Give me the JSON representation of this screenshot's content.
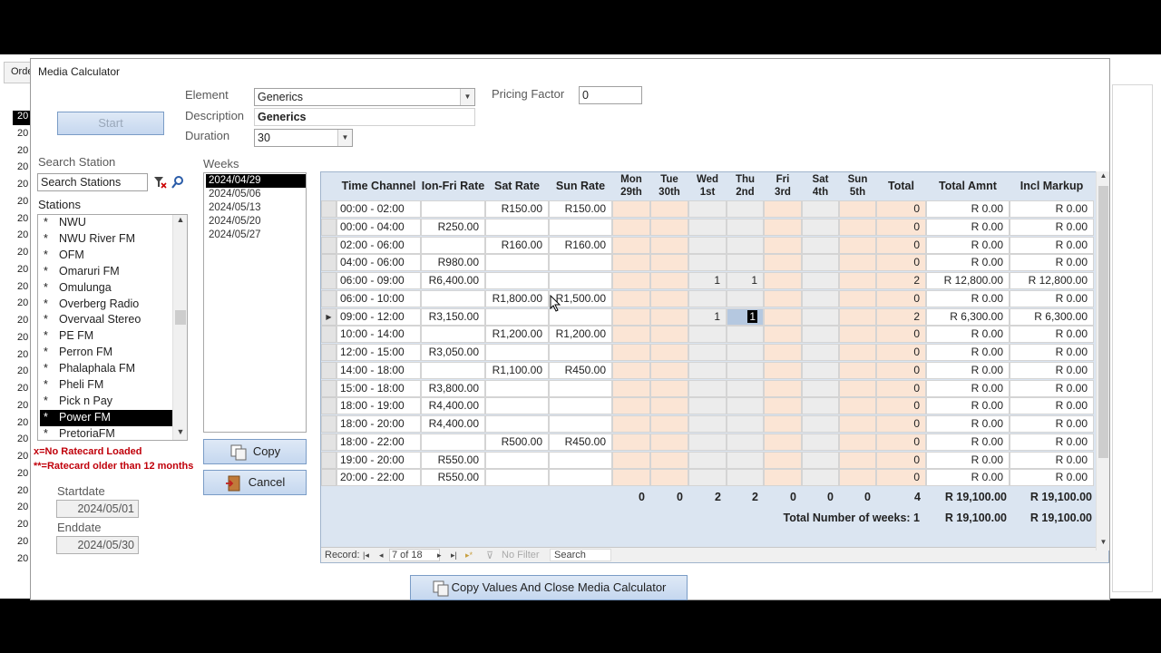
{
  "background_app": {
    "tab_label": "Orde",
    "year_list": [
      "20",
      "20",
      "20",
      "20",
      "20",
      "20",
      "20",
      "20",
      "20",
      "20",
      "20",
      "20",
      "20",
      "20",
      "20",
      "20",
      "20",
      "20",
      "20",
      "20",
      "20",
      "20",
      "20",
      "20",
      "20",
      "20",
      "20"
    ]
  },
  "dialog": {
    "title": "Media Calculator",
    "start_button": "Start",
    "element_label": "Element",
    "element_value": "Generics",
    "description_label": "Description",
    "description_value": "Generics",
    "duration_label": "Duration",
    "duration_value": "30",
    "pricing_factor_label": "Pricing Factor",
    "pricing_factor_value": "0",
    "search_station_label": "Search Station",
    "search_station_value": "Search Stations",
    "stations_label": "Stations",
    "stations": [
      {
        "mark": "*",
        "name": "NWU",
        "selected": false
      },
      {
        "mark": "*",
        "name": "NWU River FM",
        "selected": false
      },
      {
        "mark": "*",
        "name": "OFM",
        "selected": false
      },
      {
        "mark": "*",
        "name": "Omaruri FM",
        "selected": false
      },
      {
        "mark": "*",
        "name": "Omulunga",
        "selected": false
      },
      {
        "mark": "*",
        "name": "Overberg Radio",
        "selected": false
      },
      {
        "mark": "*",
        "name": "Overvaal Stereo",
        "selected": false
      },
      {
        "mark": "*",
        "name": "PE FM",
        "selected": false
      },
      {
        "mark": "*",
        "name": "Perron FM",
        "selected": false
      },
      {
        "mark": "*",
        "name": "Phalaphala FM",
        "selected": false
      },
      {
        "mark": "*",
        "name": "Pheli FM",
        "selected": false
      },
      {
        "mark": "*",
        "name": "Pick n Pay",
        "selected": false
      },
      {
        "mark": "*",
        "name": "Power FM",
        "selected": true
      },
      {
        "mark": "*",
        "name": "PretoriaFM",
        "selected": false
      }
    ],
    "note_no_ratecard": "x=No Ratecard Loaded",
    "note_old_ratecard": "**=Ratecard older than 12 months",
    "startdate_label": "Startdate",
    "startdate_value": "2024/05/01",
    "enddate_label": "Enddate",
    "enddate_value": "2024/05/30",
    "weeks_label": "Weeks",
    "weeks": [
      {
        "label": "2024/04/29",
        "selected": true
      },
      {
        "label": "2024/05/06",
        "selected": false
      },
      {
        "label": "2024/05/13",
        "selected": false
      },
      {
        "label": "2024/05/20",
        "selected": false
      },
      {
        "label": "2024/05/27",
        "selected": false
      }
    ],
    "copy_button": "Copy",
    "cancel_button": "Cancel",
    "copy_close_button": "Copy Values And Close Media Calculator"
  },
  "grid": {
    "headers": {
      "time_channel": "Time Channel",
      "mon_fri_rate": "Ion-Fri Rate",
      "sat_rate": "Sat Rate",
      "sun_rate": "Sun Rate",
      "mon": [
        "Mon",
        "29th"
      ],
      "tue": [
        "Tue",
        "30th"
      ],
      "wed": [
        "Wed",
        "1st"
      ],
      "thu": [
        "Thu",
        "2nd"
      ],
      "fri": [
        "Fri",
        "3rd"
      ],
      "sat": [
        "Sat",
        "4th"
      ],
      "sun": [
        "Sun",
        "5th"
      ],
      "total": "Total",
      "total_amnt": "Total Amnt",
      "incl_markup": "Incl Markup"
    },
    "rows": [
      {
        "time": "00:00 - 02:00",
        "mf": "",
        "sat": "R150.00",
        "sun": "R150.00",
        "mon": "",
        "tue": "",
        "wed": "",
        "thu": "",
        "fri": "",
        "sa": "",
        "su": "",
        "total": "0",
        "amnt": "R 0.00",
        "markup": "R 0.00"
      },
      {
        "time": "00:00 - 04:00",
        "mf": "R250.00",
        "sat": "",
        "sun": "",
        "mon": "",
        "tue": "",
        "wed": "",
        "thu": "",
        "fri": "",
        "sa": "",
        "su": "",
        "total": "0",
        "amnt": "R 0.00",
        "markup": "R 0.00"
      },
      {
        "time": "02:00 - 06:00",
        "mf": "",
        "sat": "R160.00",
        "sun": "R160.00",
        "mon": "",
        "tue": "",
        "wed": "",
        "thu": "",
        "fri": "",
        "sa": "",
        "su": "",
        "total": "0",
        "amnt": "R 0.00",
        "markup": "R 0.00"
      },
      {
        "time": "04:00 - 06:00",
        "mf": "R980.00",
        "sat": "",
        "sun": "",
        "mon": "",
        "tue": "",
        "wed": "",
        "thu": "",
        "fri": "",
        "sa": "",
        "su": "",
        "total": "0",
        "amnt": "R 0.00",
        "markup": "R 0.00"
      },
      {
        "time": "06:00 - 09:00",
        "mf": "R6,400.00",
        "sat": "",
        "sun": "",
        "mon": "",
        "tue": "",
        "wed": "1",
        "thu": "1",
        "fri": "",
        "sa": "",
        "su": "",
        "total": "2",
        "amnt": "R 12,800.00",
        "markup": "R 12,800.00"
      },
      {
        "time": "06:00 - 10:00",
        "mf": "",
        "sat": "R1,800.00",
        "sun": "R1,500.00",
        "mon": "",
        "tue": "",
        "wed": "",
        "thu": "",
        "fri": "",
        "sa": "",
        "su": "",
        "total": "0",
        "amnt": "R 0.00",
        "markup": "R 0.00"
      },
      {
        "time": "09:00 - 12:00",
        "mf": "R3,150.00",
        "sat": "",
        "sun": "",
        "mon": "",
        "tue": "",
        "wed": "1",
        "thu": "1",
        "fri": "",
        "sa": "",
        "su": "",
        "total": "2",
        "amnt": "R 6,300.00",
        "markup": "R 6,300.00"
      },
      {
        "time": "10:00 - 14:00",
        "mf": "",
        "sat": "R1,200.00",
        "sun": "R1,200.00",
        "mon": "",
        "tue": "",
        "wed": "",
        "thu": "",
        "fri": "",
        "sa": "",
        "su": "",
        "total": "0",
        "amnt": "R 0.00",
        "markup": "R 0.00"
      },
      {
        "time": "12:00 - 15:00",
        "mf": "R3,050.00",
        "sat": "",
        "sun": "",
        "mon": "",
        "tue": "",
        "wed": "",
        "thu": "",
        "fri": "",
        "sa": "",
        "su": "",
        "total": "0",
        "amnt": "R 0.00",
        "markup": "R 0.00"
      },
      {
        "time": "14:00 - 18:00",
        "mf": "",
        "sat": "R1,100.00",
        "sun": "R450.00",
        "mon": "",
        "tue": "",
        "wed": "",
        "thu": "",
        "fri": "",
        "sa": "",
        "su": "",
        "total": "0",
        "amnt": "R 0.00",
        "markup": "R 0.00"
      },
      {
        "time": "15:00 - 18:00",
        "mf": "R3,800.00",
        "sat": "",
        "sun": "",
        "mon": "",
        "tue": "",
        "wed": "",
        "thu": "",
        "fri": "",
        "sa": "",
        "su": "",
        "total": "0",
        "amnt": "R 0.00",
        "markup": "R 0.00"
      },
      {
        "time": "18:00 - 19:00",
        "mf": "R4,400.00",
        "sat": "",
        "sun": "",
        "mon": "",
        "tue": "",
        "wed": "",
        "thu": "",
        "fri": "",
        "sa": "",
        "su": "",
        "total": "0",
        "amnt": "R 0.00",
        "markup": "R 0.00"
      },
      {
        "time": "18:00 - 20:00",
        "mf": "R4,400.00",
        "sat": "",
        "sun": "",
        "mon": "",
        "tue": "",
        "wed": "",
        "thu": "",
        "fri": "",
        "sa": "",
        "su": "",
        "total": "0",
        "amnt": "R 0.00",
        "markup": "R 0.00"
      },
      {
        "time": "18:00 - 22:00",
        "mf": "",
        "sat": "R500.00",
        "sun": "R450.00",
        "mon": "",
        "tue": "",
        "wed": "",
        "thu": "",
        "fri": "",
        "sa": "",
        "su": "",
        "total": "0",
        "amnt": "R 0.00",
        "markup": "R 0.00"
      },
      {
        "time": "19:00 - 20:00",
        "mf": "R550.00",
        "sat": "",
        "sun": "",
        "mon": "",
        "tue": "",
        "wed": "",
        "thu": "",
        "fri": "",
        "sa": "",
        "su": "",
        "total": "0",
        "amnt": "R 0.00",
        "markup": "R 0.00"
      },
      {
        "time": "20:00 - 22:00",
        "mf": "R550.00",
        "sat": "",
        "sun": "",
        "mon": "",
        "tue": "",
        "wed": "",
        "thu": "",
        "fri": "",
        "sa": "",
        "su": "",
        "total": "0",
        "amnt": "R 0.00",
        "markup": "R 0.00"
      }
    ],
    "current_row": 6,
    "day_totals": [
      "0",
      "0",
      "2",
      "2",
      "0",
      "0",
      "0",
      "4"
    ],
    "sum_total_amnt": "R 19,100.00",
    "sum_incl_markup": "R 19,100.00",
    "weeks_label": "Total Number of weeks: 1",
    "weeks_total_amnt": "R 19,100.00",
    "weeks_incl_markup": "R 19,100.00",
    "nav": {
      "record_label": "Record:",
      "position": "7 of 18",
      "filter": "No Filter",
      "search": "Search"
    }
  },
  "colors": {
    "weekday_cell": "#fbe5d5",
    "weekend_cell": "#ececec",
    "subform_bg": "#dbe5f1",
    "note_red": "#c0000a"
  }
}
